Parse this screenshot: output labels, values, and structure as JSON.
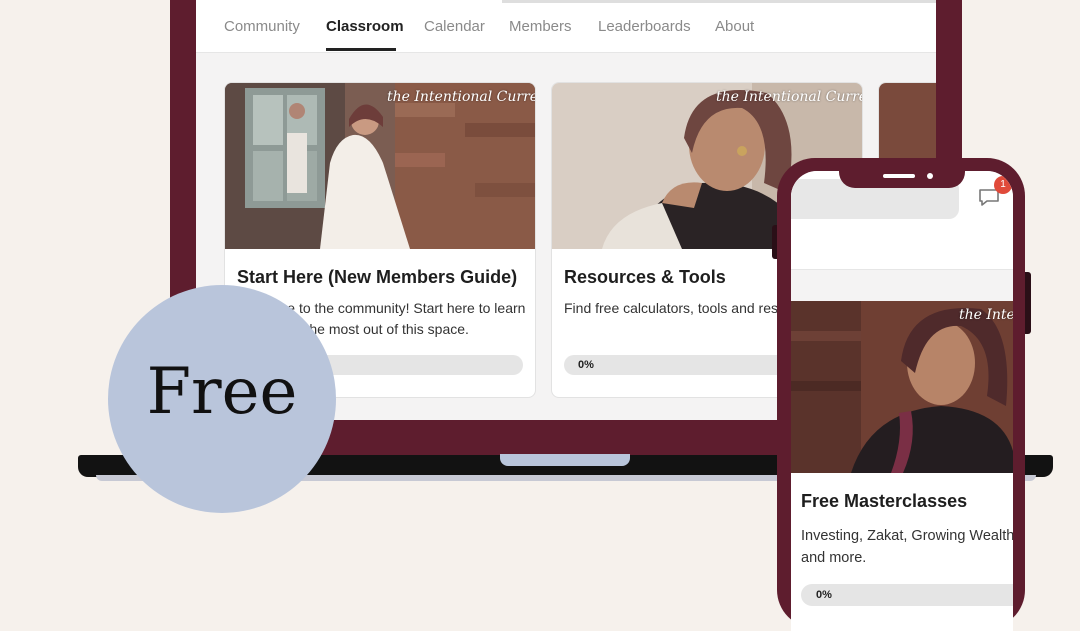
{
  "tabs": [
    "Community",
    "Classroom",
    "Calendar",
    "Members",
    "Leaderboards",
    "About"
  ],
  "active_tab": "Classroom",
  "watermark": "the Intentional Currency",
  "courses": [
    {
      "title": "Start Here (New Members Guide)",
      "description": "Welcome to the community! Start here to learn how to get the most out of this space.",
      "progress": 0,
      "progress_label": ""
    },
    {
      "title": "Resources & Tools",
      "description": "Find free calculators, tools and resources.",
      "progress": 0,
      "progress_label": "0%"
    }
  ],
  "badge": "Free",
  "phone": {
    "notification_count": "1",
    "course": {
      "title": "Free Masterclasses",
      "description": "Investing, Zakat, Growing Wealth and more.",
      "progress": 0,
      "progress_label": "0%"
    }
  },
  "colors": {
    "background": "#f6f1ec",
    "frame": "#5e1d2e",
    "badge": "#b9c5db",
    "notification": "#e04a3a"
  }
}
